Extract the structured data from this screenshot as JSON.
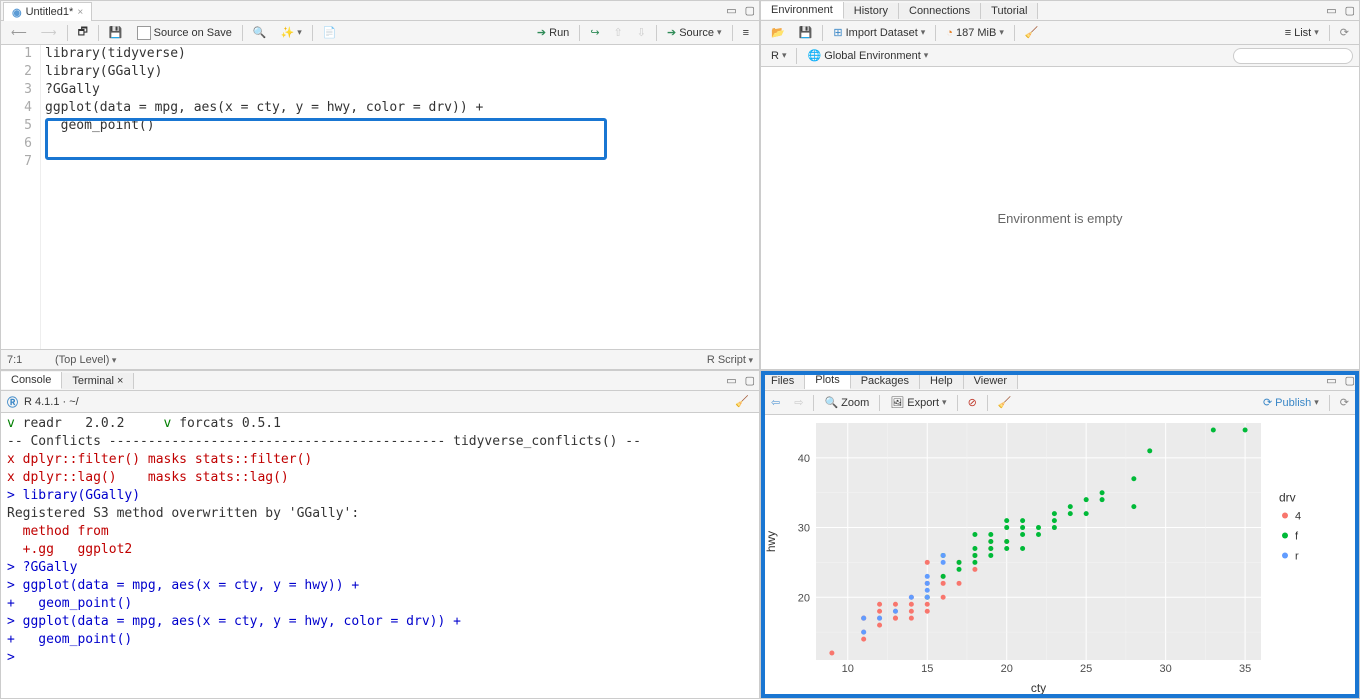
{
  "source": {
    "tab_title": "Untitled1*",
    "source_on_save": "Source on Save",
    "run": "Run",
    "source_btn": "Source",
    "pos": "7:1",
    "scope": "(Top Level)",
    "type": "R Script",
    "lines": [
      "1",
      "2",
      "3",
      "4",
      "5",
      "6",
      "7"
    ],
    "code1": "library(tidyverse)",
    "code2": "library(GGally)",
    "code3": "?GGally",
    "code4": "",
    "code5": "ggplot(data = mpg, aes(x = cty, y = hwy, color = drv)) +",
    "code6": "  geom_point()",
    "code7": ""
  },
  "console": {
    "tab_console": "Console",
    "tab_terminal": "Terminal",
    "prompt_info": "R 4.1.1 · ~/",
    "out": [
      {
        "cls": "",
        "txt": "v readr   2.0.2     v forcats 0.5.1",
        "pfx": "r-green"
      },
      {
        "cls": "",
        "txt": "-- Conflicts ------------------------------------------- tidyverse_conflicts() --"
      },
      {
        "cls": "r-red",
        "txt": "x dplyr::filter() masks stats::filter()"
      },
      {
        "cls": "r-red",
        "txt": "x dplyr::lag()    masks stats::lag()"
      },
      {
        "cls": "r-blue",
        "txt": "> library(GGally)"
      },
      {
        "cls": "",
        "txt": "Registered S3 method overwritten by 'GGally':"
      },
      {
        "cls": "r-red",
        "txt": "  method from"
      },
      {
        "cls": "r-red",
        "txt": "  +.gg   ggplot2"
      },
      {
        "cls": "r-blue",
        "txt": "> ?GGally"
      },
      {
        "cls": "r-blue",
        "txt": "> ggplot(data = mpg, aes(x = cty, y = hwy)) +"
      },
      {
        "cls": "r-blue",
        "txt": "+   geom_point()"
      },
      {
        "cls": "r-blue",
        "txt": "> ggplot(data = mpg, aes(x = cty, y = hwy, color = drv)) +"
      },
      {
        "cls": "r-blue",
        "txt": "+   geom_point()"
      },
      {
        "cls": "r-blue",
        "txt": "> "
      }
    ]
  },
  "env": {
    "tabs": [
      "Environment",
      "History",
      "Connections",
      "Tutorial"
    ],
    "import": "Import Dataset",
    "mem": "187 MiB",
    "list": "List",
    "r_dd": "R",
    "scope": "Global Environment",
    "empty": "Environment is empty",
    "search_ph": ""
  },
  "plots": {
    "tabs": [
      "Files",
      "Plots",
      "Packages",
      "Help",
      "Viewer"
    ],
    "zoom": "Zoom",
    "export": "Export",
    "publish": "Publish"
  },
  "chart_data": {
    "type": "scatter",
    "title": "",
    "xlabel": "cty",
    "ylabel": "hwy",
    "xlim": [
      8,
      36
    ],
    "ylim": [
      11,
      45
    ],
    "xticks": [
      10,
      15,
      20,
      25,
      30,
      35
    ],
    "yticks": [
      20,
      30,
      40
    ],
    "legend_title": "drv",
    "legend_pos": "right",
    "colors": {
      "4": "#F8766D",
      "f": "#00BA38",
      "r": "#619CFF"
    },
    "series": [
      {
        "name": "4",
        "values": [
          [
            9,
            12
          ],
          [
            11,
            14
          ],
          [
            11,
            15
          ],
          [
            11,
            17
          ],
          [
            11,
            17
          ],
          [
            12,
            16
          ],
          [
            12,
            17
          ],
          [
            12,
            18
          ],
          [
            12,
            19
          ],
          [
            13,
            17
          ],
          [
            13,
            17
          ],
          [
            13,
            18
          ],
          [
            13,
            19
          ],
          [
            14,
            17
          ],
          [
            14,
            18
          ],
          [
            14,
            19
          ],
          [
            14,
            20
          ],
          [
            15,
            18
          ],
          [
            15,
            19
          ],
          [
            15,
            20
          ],
          [
            15,
            22
          ],
          [
            15,
            25
          ],
          [
            16,
            20
          ],
          [
            16,
            22
          ],
          [
            16,
            23
          ],
          [
            17,
            22
          ],
          [
            17,
            25
          ],
          [
            18,
            24
          ],
          [
            18,
            26
          ],
          [
            19,
            27
          ],
          [
            19,
            28
          ],
          [
            20,
            28
          ]
        ]
      },
      {
        "name": "f",
        "values": [
          [
            15,
            20
          ],
          [
            16,
            23
          ],
          [
            16,
            26
          ],
          [
            17,
            24
          ],
          [
            17,
            25
          ],
          [
            18,
            25
          ],
          [
            18,
            26
          ],
          [
            18,
            27
          ],
          [
            18,
            29
          ],
          [
            19,
            26
          ],
          [
            19,
            27
          ],
          [
            19,
            28
          ],
          [
            19,
            29
          ],
          [
            20,
            27
          ],
          [
            20,
            28
          ],
          [
            20,
            30
          ],
          [
            20,
            31
          ],
          [
            21,
            27
          ],
          [
            21,
            29
          ],
          [
            21,
            30
          ],
          [
            21,
            31
          ],
          [
            22,
            29
          ],
          [
            22,
            30
          ],
          [
            23,
            30
          ],
          [
            23,
            31
          ],
          [
            23,
            32
          ],
          [
            24,
            32
          ],
          [
            24,
            33
          ],
          [
            25,
            32
          ],
          [
            25,
            34
          ],
          [
            26,
            34
          ],
          [
            26,
            35
          ],
          [
            28,
            33
          ],
          [
            28,
            37
          ],
          [
            29,
            41
          ],
          [
            33,
            44
          ],
          [
            35,
            44
          ]
        ]
      },
      {
        "name": "r",
        "values": [
          [
            11,
            15
          ],
          [
            11,
            17
          ],
          [
            12,
            17
          ],
          [
            13,
            18
          ],
          [
            14,
            20
          ],
          [
            15,
            20
          ],
          [
            15,
            21
          ],
          [
            15,
            22
          ],
          [
            15,
            23
          ],
          [
            16,
            25
          ],
          [
            16,
            26
          ]
        ]
      }
    ]
  }
}
